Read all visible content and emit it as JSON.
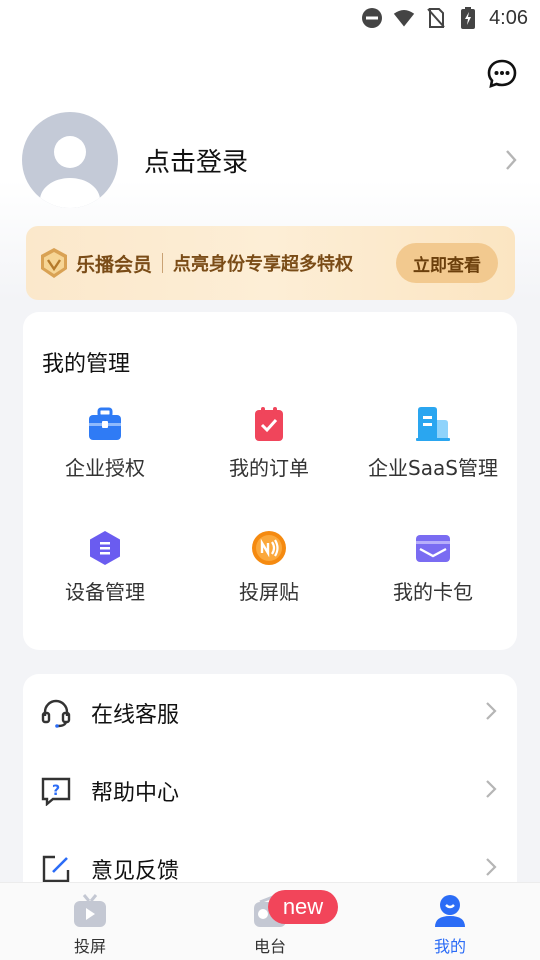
{
  "status_bar": {
    "time": "4:06",
    "icons": [
      "dnd-icon",
      "wifi-icon",
      "no-sim-icon",
      "battery-charging-icon"
    ]
  },
  "header": {
    "message_icon": "chat-bubble-icon"
  },
  "profile": {
    "login_label": "点击登录",
    "avatar_icon": "default-avatar-icon"
  },
  "vip": {
    "title": "乐播会员",
    "description": "点亮身份专享超多特权",
    "button_label": "立即查看",
    "badge_icon": "vip-shield-icon"
  },
  "management": {
    "title": "我的管理",
    "items": [
      {
        "label": "企业授权",
        "icon": "briefcase-icon",
        "color": "#2f7bf5"
      },
      {
        "label": "我的订单",
        "icon": "order-clipboard-icon",
        "color": "#f0455b"
      },
      {
        "label": "企业SaaS管理",
        "icon": "building-icon",
        "color": "#2aa6f0"
      },
      {
        "label": "设备管理",
        "icon": "hexagon-device-icon",
        "color": "#6a5cf0"
      },
      {
        "label": "投屏贴",
        "icon": "nfc-sticker-icon",
        "color": "#f58a10"
      },
      {
        "label": "我的卡包",
        "icon": "card-wallet-icon",
        "color": "#7a6cf2"
      }
    ]
  },
  "services": [
    {
      "label": "在线客服",
      "icon": "headset-icon"
    },
    {
      "label": "帮助中心",
      "icon": "help-question-icon"
    },
    {
      "label": "意见反馈",
      "icon": "edit-feedback-icon"
    }
  ],
  "tabbar": {
    "tabs": [
      {
        "label": "投屏",
        "icon": "tv-play-icon"
      },
      {
        "label": "电台",
        "icon": "radio-icon"
      },
      {
        "label": "我的",
        "icon": "user-profile-icon"
      }
    ],
    "badge": "new",
    "active_color": "#2b6cf6"
  }
}
